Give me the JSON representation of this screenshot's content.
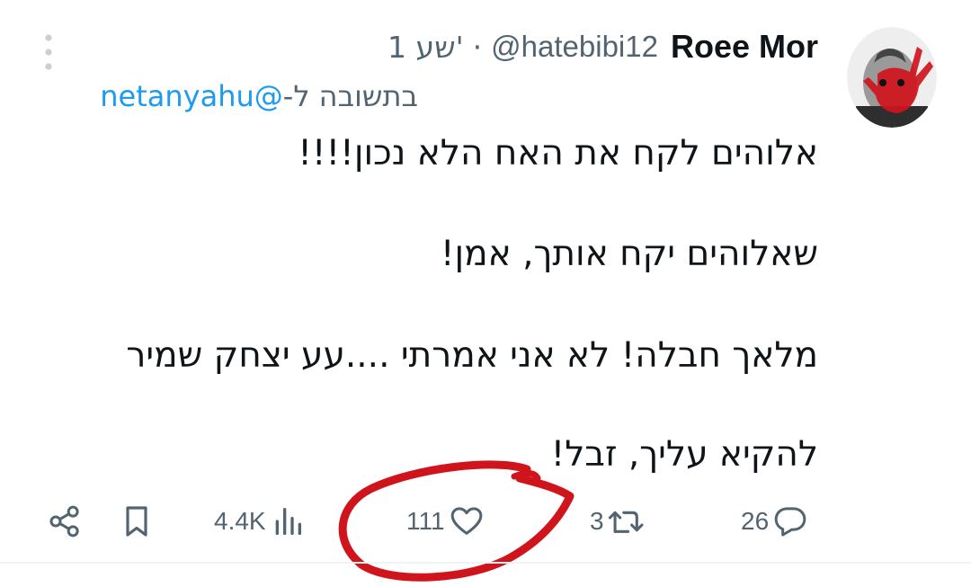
{
  "tweet": {
    "author_name": "Roee Mor",
    "handle": "@hatebibi12",
    "separator": "·",
    "time": "1 שע'",
    "reply_prefix": "בתשובה ל-",
    "reply_to": "@netanyahu",
    "lines": [
      "אלוהים לקח את האח הלא נכון!!!!",
      "שאלוהים יקח אותך, אמן!",
      "מלאך חבלה! לא אני אמרתי ....עע יצחק שמיר",
      "להקיא עליך, זבל!"
    ]
  },
  "actions": {
    "replies": "26",
    "retweets": "3",
    "likes": "111",
    "views": "4.4K"
  },
  "icons": [
    "share-icon",
    "bookmark-icon",
    "views-icon",
    "heart-icon",
    "retweet-icon",
    "reply-icon",
    "more-icon"
  ],
  "colors": {
    "accent": "#1d9bf0",
    "secondary_text": "#536471",
    "annotation_red": "#d0141c"
  }
}
